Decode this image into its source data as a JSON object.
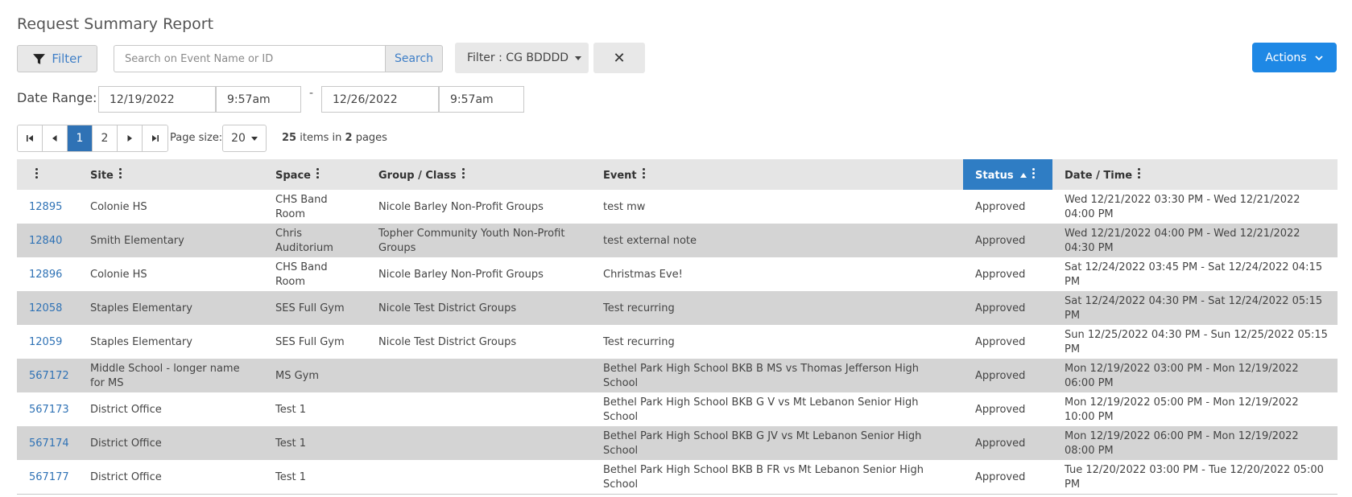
{
  "page": {
    "title": "Request Summary Report"
  },
  "toolbar": {
    "filter_label": "Filter",
    "search_placeholder": "Search on Event Name or ID",
    "search_button": "Search",
    "active_filter": "Filter : CG BDDDD",
    "clear_symbol": "✕",
    "actions_label": "Actions"
  },
  "date_range": {
    "label": "Date Range:",
    "start_date": "12/19/2022",
    "start_time": "9:57am",
    "separator": "-",
    "end_date": "12/26/2022",
    "end_time": "9:57am"
  },
  "pager": {
    "pages": [
      "1",
      "2"
    ],
    "current_page": "1",
    "page_size_label": "Page size:",
    "page_size": "20",
    "total_items": "25",
    "items_in_text": "items in",
    "total_pages": "2",
    "pages_text": "pages"
  },
  "table": {
    "columns": [
      "",
      "Site",
      "Space",
      "Group / Class",
      "Event",
      "Status",
      "Date / Time"
    ],
    "sorted_column": "Status",
    "sort_direction": "ascending",
    "rows": [
      {
        "id": "12895",
        "site": "Colonie HS",
        "space": "CHS Band Room",
        "group": "Nicole Barley Non-Profit Groups",
        "event": "test mw",
        "status": "Approved",
        "datetime": "Wed 12/21/2022 03:30 PM - Wed 12/21/2022 04:00 PM"
      },
      {
        "id": "12840",
        "site": "Smith Elementary",
        "space": "Chris Auditorium",
        "group": "Topher Community Youth Non-Profit Groups",
        "event": "test external note",
        "status": "Approved",
        "datetime": "Wed 12/21/2022 04:00 PM - Wed 12/21/2022 04:30 PM"
      },
      {
        "id": "12896",
        "site": "Colonie HS",
        "space": "CHS Band Room",
        "group": "Nicole Barley Non-Profit Groups",
        "event": "Christmas Eve!",
        "status": "Approved",
        "datetime": "Sat 12/24/2022 03:45 PM - Sat 12/24/2022 04:15 PM"
      },
      {
        "id": "12058",
        "site": "Staples Elementary",
        "space": "SES Full Gym",
        "group": "Nicole Test District Groups",
        "event": "Test recurring",
        "status": "Approved",
        "datetime": "Sat 12/24/2022 04:30 PM - Sat 12/24/2022 05:15 PM"
      },
      {
        "id": "12059",
        "site": "Staples Elementary",
        "space": "SES Full Gym",
        "group": "Nicole Test District Groups",
        "event": "Test recurring",
        "status": "Approved",
        "datetime": "Sun 12/25/2022 04:30 PM - Sun 12/25/2022 05:15 PM"
      },
      {
        "id": "567172",
        "site": "Middle School - longer name for MS",
        "space": "MS Gym",
        "group": "",
        "event": "Bethel Park High School BKB B MS vs Thomas Jefferson High School",
        "status": "Approved",
        "datetime": "Mon 12/19/2022 03:00 PM - Mon 12/19/2022 06:00 PM"
      },
      {
        "id": "567173",
        "site": "District Office",
        "space": "Test 1",
        "group": "",
        "event": "Bethel Park High School BKB G V vs Mt Lebanon Senior High School",
        "status": "Approved",
        "datetime": "Mon 12/19/2022 05:00 PM - Mon 12/19/2022 10:00 PM"
      },
      {
        "id": "567174",
        "site": "District Office",
        "space": "Test 1",
        "group": "",
        "event": "Bethel Park High School BKB G JV vs Mt Lebanon Senior High School",
        "status": "Approved",
        "datetime": "Mon 12/19/2022 06:00 PM - Mon 12/19/2022 08:00 PM"
      },
      {
        "id": "567177",
        "site": "District Office",
        "space": "Test 1",
        "group": "",
        "event": "Bethel Park High School BKB B FR vs Mt Lebanon Senior High School",
        "status": "Approved",
        "datetime": "Tue 12/20/2022 03:00 PM - Tue 12/20/2022 05:00 PM"
      }
    ]
  },
  "icons": {
    "filter": "funnel-icon",
    "clear": "close-icon",
    "actions": "chevron-down-icon",
    "column_menu": "kebab-icon",
    "sort": "sort-up-icon"
  },
  "colors": {
    "accent": "#1e88e5",
    "sorted_header": "#2f7dc4",
    "link": "#2f72b5",
    "row_alt": "#d4d4d4",
    "header_bg": "#e5e5e5"
  }
}
